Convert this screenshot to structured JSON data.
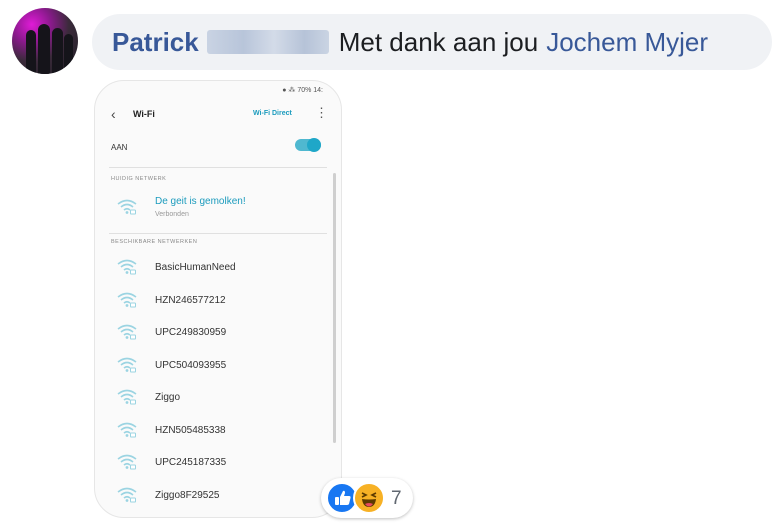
{
  "comment": {
    "author": "Patrick",
    "text": "Met dank aan jou",
    "mention": "Jochem Myjer"
  },
  "screenshot": {
    "status_bar": "70% 14:",
    "title": "Wi-Fi",
    "wifi_direct": "Wi-Fi Direct",
    "toggle_label": "AAN",
    "toggle_on": true,
    "current_section": "HUIDIG NETWERK",
    "current_network": {
      "name": "De geit is gemolken!",
      "status": "Verbonden"
    },
    "available_section": "BESCHIKBARE NETWERKEN",
    "networks": [
      "BasicHumanNeed",
      "HZN246577212",
      "UPC249830959",
      "UPC504093955",
      "Ziggo",
      "HZN505485338",
      "UPC245187335",
      "Ziggo8F29525"
    ],
    "accent_color": "#1b9bbd"
  },
  "reactions": {
    "icons": [
      "like-icon",
      "haha-icon"
    ],
    "count": "7"
  }
}
